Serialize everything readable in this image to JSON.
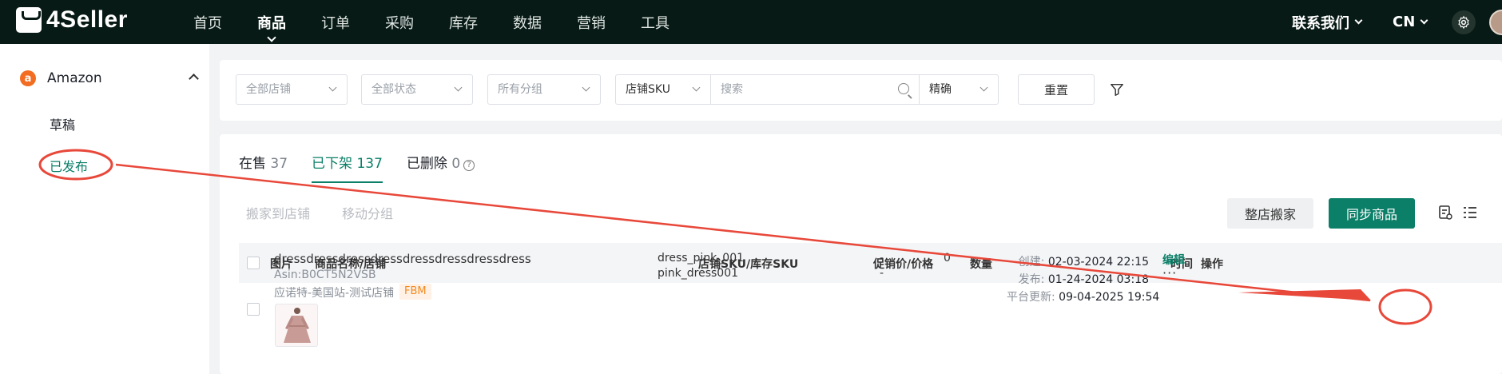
{
  "brand": {
    "name": "4Seller"
  },
  "nav": {
    "items": [
      {
        "label": "首页"
      },
      {
        "label": "商品",
        "active": true
      },
      {
        "label": "订单"
      },
      {
        "label": "采购"
      },
      {
        "label": "库存"
      },
      {
        "label": "数据"
      },
      {
        "label": "营销"
      },
      {
        "label": "工具"
      }
    ],
    "contact": "联系我们",
    "lang": "CN"
  },
  "sidebar": {
    "platform": "Amazon",
    "platform_icon": "a",
    "items": [
      {
        "label": "草稿"
      },
      {
        "label": "已发布",
        "active": true
      }
    ]
  },
  "filters": {
    "store": "全部店铺",
    "status": "全部状态",
    "group": "所有分组",
    "sku_type": "店铺SKU",
    "search_placeholder": "搜索",
    "match": "精确",
    "reset": "重置"
  },
  "tabs": [
    {
      "label": "在售",
      "count": "37"
    },
    {
      "label": "已下架",
      "count": "137",
      "active": true
    },
    {
      "label": "已删除",
      "count": "0"
    }
  ],
  "toolbar": {
    "move_to_store": "搬家到店铺",
    "move_group": "移动分组",
    "whole_store_move": "整店搬家",
    "sync_products": "同步商品"
  },
  "table": {
    "headers": {
      "image": "图片",
      "name": "商品名称/店铺",
      "sku": "店铺SKU/库存SKU",
      "price": "促销价/价格",
      "qty": "数量",
      "time": "时间",
      "action": "操作"
    },
    "rows": [
      {
        "name": "dressdressdressdressdressdressdressdress",
        "asin": "Asin:B0CT5N2VSB",
        "store": "应诺特-美国站-测试店铺",
        "fulfillment": "FBM",
        "store_sku": "dress_pink_001",
        "stock_sku": "pink_dress001",
        "promo_price": "-",
        "price": "-",
        "qty": "0",
        "created_label": "创建:",
        "created": "02-03-2024 22:15",
        "published_label": "发布:",
        "published": "01-24-2024 03:18",
        "platform_updated_label": "平台更新:",
        "platform_updated": "09-04-2025 19:54",
        "edit": "编辑",
        "more": "···"
      }
    ]
  },
  "colors": {
    "topbar": "#071a15",
    "accent": "#0b7f68",
    "annotation": "#e8483a"
  }
}
